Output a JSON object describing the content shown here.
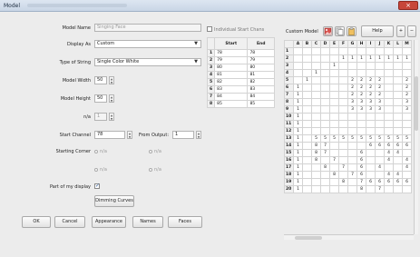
{
  "window": {
    "title": "Model",
    "close_label": "×"
  },
  "form": {
    "model_name_label": "Model Name",
    "model_name_value": "Singing Face",
    "display_as_label": "Display As",
    "display_as_value": "Custom",
    "type_of_string_label": "Type of String",
    "type_of_string_value": "Single Color White",
    "model_width_label": "Model Width",
    "model_width_value": "50",
    "model_height_label": "Model Height",
    "model_height_value": "50",
    "na_label": "n/a",
    "na_value": "1",
    "start_channel_label": "Start Channel",
    "start_channel_value": "78",
    "from_output_label": "From Output:",
    "from_output_value": "1",
    "starting_corner_label": "Starting Corner",
    "radio_na": "n/a",
    "part_of_display_label": "Part of my display",
    "dimming_curves_label": "Dimming Curves"
  },
  "bottom_buttons": {
    "ok": "OK",
    "cancel": "Cancel",
    "appearance": "Appearance",
    "names": "Names",
    "faces": "Faces"
  },
  "range": {
    "individual_start_chars_label": "Individual Start Chans",
    "headers": [
      "",
      "Start",
      "End"
    ],
    "rows": [
      [
        "1",
        "78",
        "78"
      ],
      [
        "2",
        "79",
        "79"
      ],
      [
        "3",
        "80",
        "80"
      ],
      [
        "4",
        "81",
        "81"
      ],
      [
        "5",
        "82",
        "82"
      ],
      [
        "6",
        "83",
        "83"
      ],
      [
        "7",
        "84",
        "84"
      ],
      [
        "8",
        "85",
        "85"
      ]
    ]
  },
  "custom_model": {
    "label": "Custom Model",
    "help_label": "Help",
    "plus_label": "+",
    "minus_label": "−",
    "columns": [
      "",
      "A",
      "B",
      "C",
      "D",
      "E",
      "F",
      "G",
      "H",
      "I",
      "J",
      "K",
      "L",
      "M"
    ],
    "rows": [
      [
        "1",
        "",
        "",
        "",
        "",
        "",
        "",
        "",
        "",
        "",
        "",
        "",
        "",
        ""
      ],
      [
        "2",
        "",
        "",
        "",
        "",
        "",
        "1",
        "1",
        "1",
        "1",
        "1",
        "1",
        "1",
        "1"
      ],
      [
        "3",
        "",
        "",
        "",
        "",
        "1",
        "",
        "",
        "",
        "",
        "",
        "",
        "",
        ""
      ],
      [
        "4",
        "",
        "",
        "1",
        "",
        "",
        "",
        "",
        "",
        "",
        "",
        "",
        "",
        ""
      ],
      [
        "5",
        "",
        "1",
        "",
        "",
        "",
        "",
        "2",
        "2",
        "2",
        "2",
        "",
        "",
        "2"
      ],
      [
        "6",
        "1",
        "",
        "",
        "",
        "",
        "",
        "2",
        "2",
        "2",
        "2",
        "",
        "",
        "2"
      ],
      [
        "7",
        "1",
        "",
        "",
        "",
        "",
        "",
        "2",
        "2",
        "2",
        "2",
        "",
        "",
        "2"
      ],
      [
        "8",
        "1",
        "",
        "",
        "",
        "",
        "",
        "3",
        "3",
        "3",
        "3",
        "",
        "",
        "3"
      ],
      [
        "9",
        "1",
        "",
        "",
        "",
        "",
        "",
        "3",
        "3",
        "3",
        "3",
        "",
        "",
        "3"
      ],
      [
        "10",
        "1",
        "",
        "",
        "",
        "",
        "",
        "",
        "",
        "",
        "",
        "",
        "",
        ""
      ],
      [
        "11",
        "1",
        "",
        "",
        "",
        "",
        "",
        "",
        "",
        "",
        "",
        "",
        "",
        ""
      ],
      [
        "12",
        "1",
        "",
        "",
        "",
        "",
        "",
        "",
        "",
        "",
        "",
        "",
        "",
        ""
      ],
      [
        "13",
        "1",
        "",
        "5",
        "5",
        "5",
        "5",
        "5",
        "5",
        "5",
        "5",
        "5",
        "5",
        "5"
      ],
      [
        "14",
        "1",
        "",
        "8",
        "7",
        "",
        "",
        "",
        "",
        "6",
        "6",
        "6",
        "6",
        "6"
      ],
      [
        "15",
        "1",
        "",
        "8",
        "7",
        "",
        "",
        "",
        "6",
        "",
        "",
        "4",
        "4",
        ""
      ],
      [
        "16",
        "1",
        "",
        "8",
        "",
        "7",
        "",
        "",
        "6",
        "",
        "",
        "4",
        "",
        "4"
      ],
      [
        "17",
        "1",
        "",
        "",
        "8",
        "",
        "7",
        "",
        "6",
        "",
        "4",
        "",
        "",
        "4"
      ],
      [
        "18",
        "1",
        "",
        "",
        "",
        "8",
        "",
        "7",
        "6",
        "",
        "",
        "4",
        "4",
        ""
      ],
      [
        "19",
        "1",
        "",
        "",
        "",
        "",
        "8",
        "",
        "7",
        "6",
        "6",
        "6",
        "6",
        "6"
      ],
      [
        "20",
        "1",
        "",
        "",
        "",
        "",
        "",
        "",
        "8",
        "",
        "7",
        "",
        "",
        ""
      ]
    ]
  },
  "icons": {
    "image_icon": "image-icon",
    "copy_icon": "copy-icon",
    "clipboard_icon": "clipboard-icon"
  },
  "colors": {
    "close": "#c7463a",
    "title_bar": "#c9d6e6"
  }
}
